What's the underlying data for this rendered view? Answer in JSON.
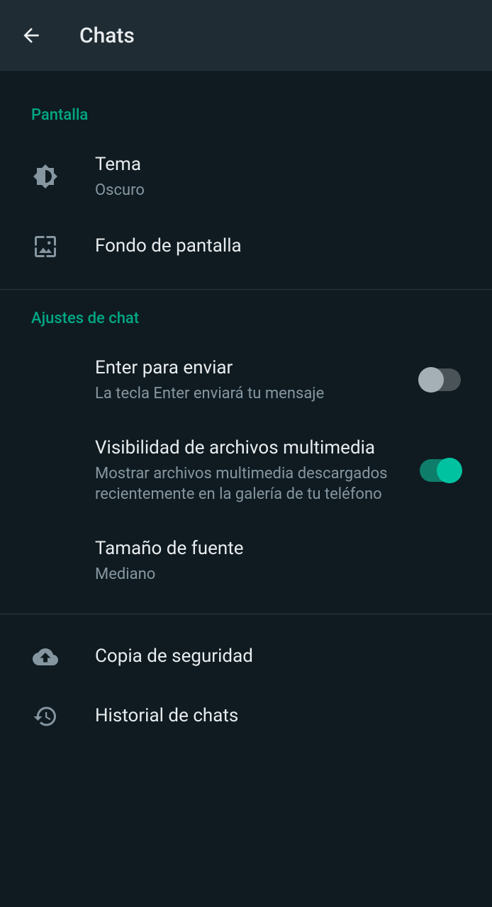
{
  "header": {
    "title": "Chats"
  },
  "sections": {
    "display": {
      "header": "Pantalla",
      "theme": {
        "title": "Tema",
        "subtitle": "Oscuro"
      },
      "wallpaper": {
        "title": "Fondo de pantalla"
      }
    },
    "chatSettings": {
      "header": "Ajustes de chat",
      "enterToSend": {
        "title": "Enter para enviar",
        "subtitle": "La tecla Enter enviará tu mensaje"
      },
      "mediaVisibility": {
        "title": "Visibilidad de archivos multimedia",
        "subtitle": "Mostrar archivos multimedia descargados recientemente en la galería de tu teléfono"
      },
      "fontSize": {
        "title": "Tamaño de fuente",
        "subtitle": "Mediano"
      }
    },
    "backup": {
      "title": "Copia de seguridad"
    },
    "history": {
      "title": "Historial de chats"
    }
  }
}
